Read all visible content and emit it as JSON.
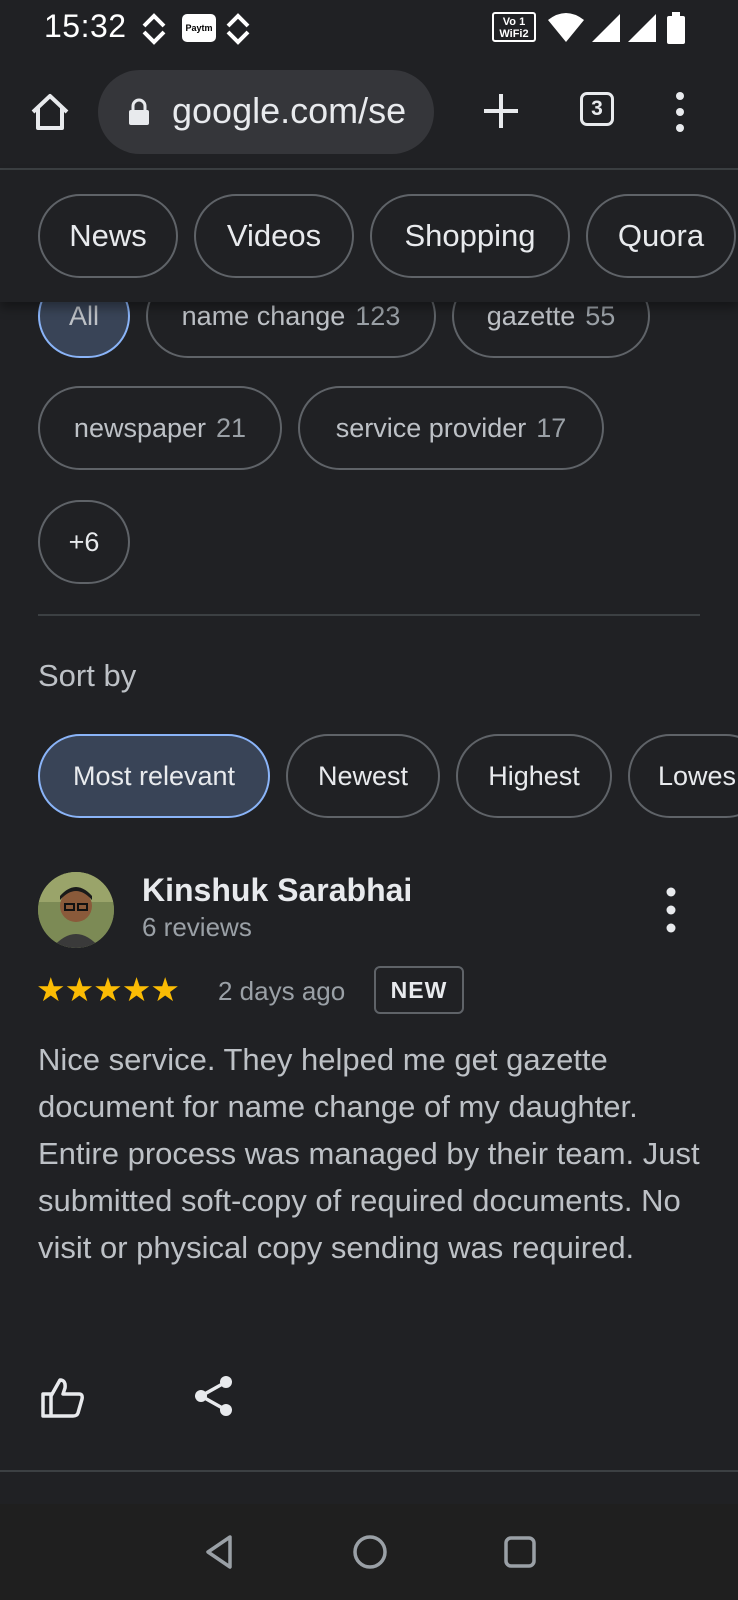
{
  "status_bar": {
    "time": "15:32",
    "paytm_label": "Paytm",
    "volte_label": "Vo 1 WiFi2",
    "icons": [
      "sync-icon",
      "paytm-icon",
      "sync-icon",
      "volte-wifi-icon",
      "wifi-icon",
      "signal-icon",
      "signal-icon",
      "battery-icon"
    ]
  },
  "browser": {
    "url": "google.com/se",
    "tab_count": "3"
  },
  "category_chips": [
    "News",
    "Videos",
    "Shopping",
    "Quora"
  ],
  "topic_chips": [
    {
      "label": "All",
      "count": ""
    },
    {
      "label": "name change",
      "count": "123"
    },
    {
      "label": "gazette",
      "count": "55"
    },
    {
      "label": "newspaper",
      "count": "21"
    },
    {
      "label": "service provider",
      "count": "17"
    },
    {
      "label": "+6",
      "count": ""
    }
  ],
  "sort": {
    "label": "Sort by",
    "options": [
      "Most relevant",
      "Newest",
      "Highest",
      "Lowes"
    ],
    "selected": "Most relevant"
  },
  "review": {
    "author": "Kinshuk Sarabhai",
    "author_reviews": "6 reviews",
    "stars": "★★★★★",
    "rating": 5,
    "time": "2 days ago",
    "badge": "NEW",
    "text": "Nice service. They helped me get gazette document for name change of my daughter. Entire process was managed by their team. Just submitted soft-copy of required documents. No visit or physical copy sending was required."
  },
  "colors": {
    "background": "#202124",
    "accent": "#8ab4f8",
    "star": "#fbbc04",
    "selected_chip": "#394457"
  }
}
